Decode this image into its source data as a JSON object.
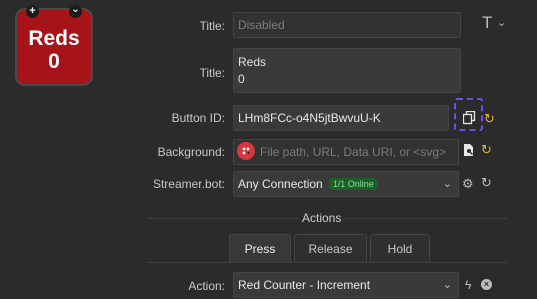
{
  "preview": {
    "title_line1": "Reds",
    "title_line2": "0",
    "add_glyph": "+",
    "menu_glyph": "⌄",
    "background_color": "#a6141a"
  },
  "fields": {
    "title_disabled": {
      "label": "Title:",
      "value": "Disabled"
    },
    "title": {
      "label": "Title:",
      "line1": "Reds",
      "line2": "0"
    },
    "button_id": {
      "label": "Button ID:",
      "value": "LHm8FCc-o4N5jtBwvuU-K"
    },
    "background": {
      "label": "Background:",
      "placeholder": "File path, URL, Data URI, or <svg>"
    },
    "streamerbot": {
      "label": "Streamer.bot:",
      "value": "Any Connection",
      "badge": "1/1 Online"
    }
  },
  "actions": {
    "section_title": "Actions",
    "tabs": [
      {
        "label": "Press",
        "active": true
      },
      {
        "label": "Release",
        "active": false
      },
      {
        "label": "Hold",
        "active": false
      }
    ],
    "action_label": "Action:",
    "action_value": "Red Counter - Increment"
  },
  "colors": {
    "accent_highlight": "#6f4ef0",
    "refresh_icon": "#e0b43a",
    "online_badge": "#1f5e2b"
  }
}
